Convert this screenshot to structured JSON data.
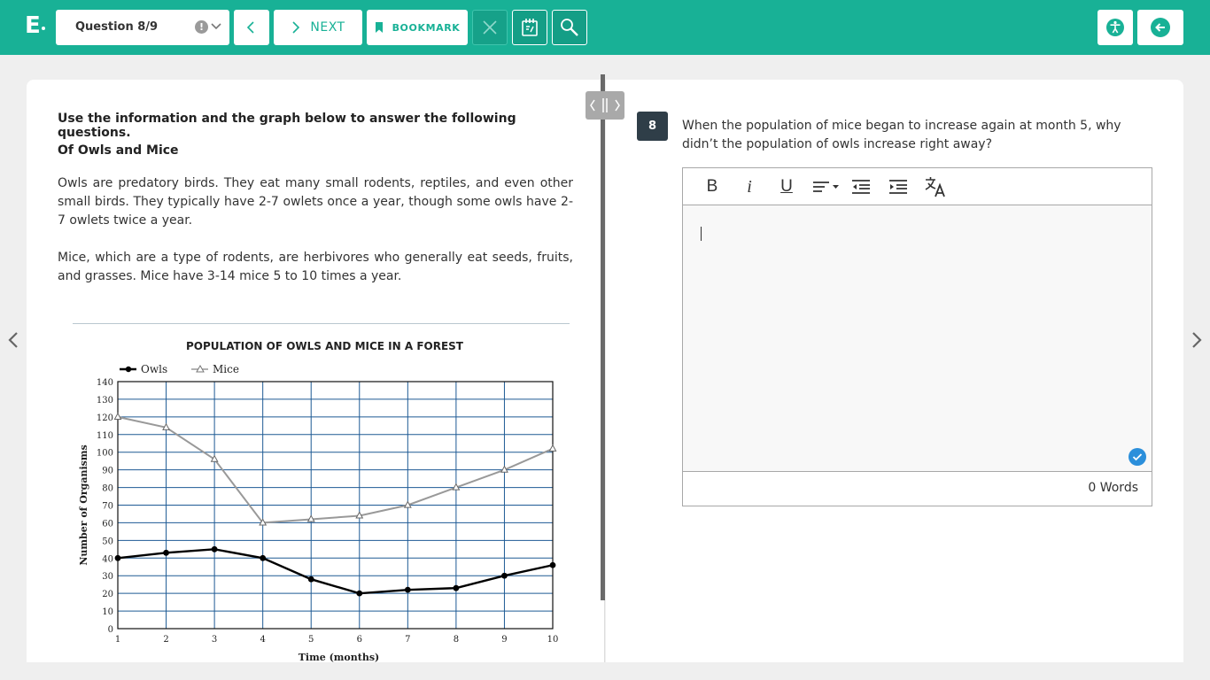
{
  "header": {
    "logo": "E",
    "question_selector": "Question 8/9",
    "warn_glyph": "!",
    "next_label": "NEXT",
    "bookmark_label": "BOOKMARK"
  },
  "passage": {
    "instructions": "Use the information and the graph below to answer the following questions.",
    "title": "Of Owls and Mice",
    "paragraphs": [
      "Owls are predatory birds. They eat many small rodents, reptiles, and even other small birds. They typically have 2-7 owlets once a year, though some owls have 2-7 owlets twice a year.",
      "Mice, which are a type of rodents, are herbivores who generally eat seeds, fruits, and grasses. Mice have 3-14 mice 5 to 10 times a year."
    ]
  },
  "chart_data": {
    "type": "line",
    "title": "POPULATION OF OWLS AND MICE IN A FOREST",
    "xlabel": "Time (months)",
    "ylabel": "Number of Organisms",
    "x": [
      1,
      2,
      3,
      4,
      5,
      6,
      7,
      8,
      9,
      10
    ],
    "xlim": [
      1,
      10
    ],
    "ylim": [
      0,
      140
    ],
    "yticks": [
      0,
      10,
      20,
      30,
      40,
      50,
      60,
      70,
      80,
      90,
      100,
      110,
      120,
      130,
      140
    ],
    "grid": true,
    "legend": "top-left",
    "series": [
      {
        "name": "Owls",
        "marker": "circle",
        "color": "#000000",
        "values": [
          40,
          43,
          45,
          40,
          28,
          20,
          22,
          23,
          30,
          36
        ]
      },
      {
        "name": "Mice",
        "marker": "triangle",
        "color": "#999999",
        "values": [
          120,
          114,
          96,
          60,
          62,
          64,
          70,
          80,
          90,
          102
        ]
      }
    ],
    "grid_color": "#1e5a94"
  },
  "question": {
    "number": "8",
    "text": "When the population of mice began to increase again at month 5, why didn’t the population of owls increase right away?"
  },
  "editor": {
    "tools": {
      "bold": "B",
      "italic": "i",
      "underline": "U"
    },
    "word_count": "0 Words"
  },
  "colors": {
    "brand": "#18b196",
    "question_badge": "#2f3e48",
    "check": "#2b8fdb"
  }
}
